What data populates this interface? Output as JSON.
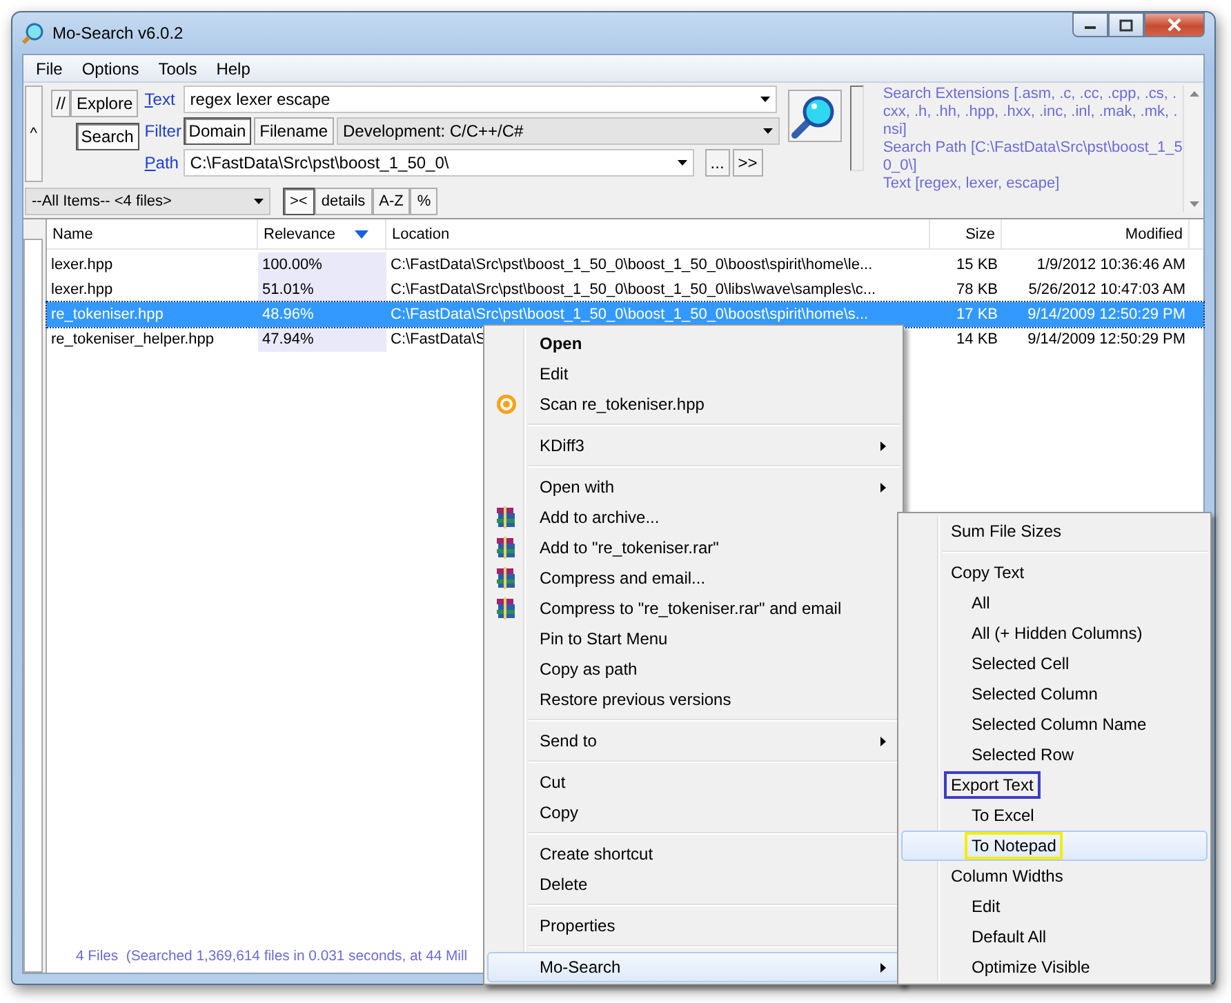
{
  "window": {
    "title": "Mo-Search v6.0.2"
  },
  "menu_bar": [
    "File",
    "Options",
    "Tools",
    "Help"
  ],
  "toolbar": {
    "collapse": "^",
    "mode_buttons": [
      {
        "label": "//",
        "selected": false
      },
      {
        "label": "Explore",
        "selected": false
      },
      {
        "label": "Search",
        "selected": true
      }
    ],
    "text": {
      "label": "Text",
      "value": "regex lexer escape"
    },
    "filter": {
      "label": "Filter",
      "toggles": [
        {
          "label": "Domain",
          "selected": true
        },
        {
          "label": "Filename",
          "selected": false
        }
      ],
      "value": "Development: C/C++/C#"
    },
    "path": {
      "label": "Path",
      "value": "C:\\FastData\\Src\\pst\\boost_1_50_0\\",
      "buttons": [
        "...",
        ">>"
      ]
    },
    "info": [
      "Search Extensions [.asm, .c, .cc, .cpp, .cs, .cxx, .h, .hh, .hpp, .hxx, .inc, .inl, .mak, .mk, .nsi]",
      "Search Path [C:\\FastData\\Src\\pst\\boost_1_50_0\\]",
      "Text [regex, lexer, escape]"
    ],
    "scope": "--All Items-- <4 files>",
    "view_buttons": [
      {
        "label": "><",
        "selected": true
      },
      {
        "label": "details",
        "selected": false
      },
      {
        "label": "A-Z",
        "selected": false
      },
      {
        "label": "%",
        "selected": false
      }
    ]
  },
  "table": {
    "columns": [
      {
        "label": "Name",
        "sorted": false
      },
      {
        "label": "Relevance",
        "sorted": true
      },
      {
        "label": "Location",
        "sorted": false
      },
      {
        "label": "Size",
        "sorted": false
      },
      {
        "label": "Modified",
        "sorted": false
      }
    ],
    "rows": [
      {
        "cells": [
          "lexer.hpp",
          "100.00%",
          "C:\\FastData\\Src\\pst\\boost_1_50_0\\boost_1_50_0\\boost\\spirit\\home\\le...",
          "15 KB",
          "1/9/2012 10:36:46 AM"
        ],
        "selected": false
      },
      {
        "cells": [
          "lexer.hpp",
          "51.01%",
          "C:\\FastData\\Src\\pst\\boost_1_50_0\\boost_1_50_0\\libs\\wave\\samples\\c...",
          "78 KB",
          "5/26/2012 10:47:03 AM"
        ],
        "selected": false
      },
      {
        "cells": [
          "re_tokeniser.hpp",
          "48.96%",
          "C:\\FastData\\Src\\pst\\boost_1_50_0\\boost_1_50_0\\boost\\spirit\\home\\s...",
          "17 KB",
          "9/14/2009 12:50:29 PM"
        ],
        "selected": true
      },
      {
        "cells": [
          "re_tokeniser_helper.hpp",
          "47.94%",
          "C:\\FastData\\S",
          "14 KB",
          "9/14/2009 12:50:29 PM"
        ],
        "selected": false
      }
    ]
  },
  "status_bar": "4 Files  (Searched 1,369,614 files in 0.031 seconds, at 44 Mill",
  "context_menu": [
    {
      "kind": "item",
      "label": "Open",
      "bold": true,
      "selected": false
    },
    {
      "kind": "item",
      "label": "Edit",
      "selected": false
    },
    {
      "kind": "scan",
      "label": "Scan re_tokeniser.hpp",
      "selected": false
    },
    {
      "kind": "separator"
    },
    {
      "kind": "item",
      "label": "KDiff3",
      "submenu": true,
      "selected": false
    },
    {
      "kind": "separator"
    },
    {
      "kind": "item",
      "label": "Open with",
      "submenu": true,
      "selected": false
    },
    {
      "kind": "archive",
      "label": "Add to archive...",
      "selected": false
    },
    {
      "kind": "archive",
      "label": "Add to \"re_tokeniser.rar\"",
      "selected": false
    },
    {
      "kind": "archive",
      "label": "Compress and email...",
      "selected": false
    },
    {
      "kind": "archive",
      "label": "Compress to \"re_tokeniser.rar\" and email",
      "selected": false
    },
    {
      "kind": "item",
      "label": "Pin to Start Menu",
      "selected": false
    },
    {
      "kind": "item",
      "label": "Copy as path",
      "selected": false
    },
    {
      "kind": "item",
      "label": "Restore previous versions",
      "selected": false
    },
    {
      "kind": "separator"
    },
    {
      "kind": "item",
      "label": "Send to",
      "submenu": true,
      "selected": false
    },
    {
      "kind": "separator"
    },
    {
      "kind": "item",
      "label": "Cut",
      "selected": false
    },
    {
      "kind": "item",
      "label": "Copy",
      "selected": false
    },
    {
      "kind": "separator"
    },
    {
      "kind": "item",
      "label": "Create shortcut",
      "selected": false
    },
    {
      "kind": "item",
      "label": "Delete",
      "selected": false
    },
    {
      "kind": "separator"
    },
    {
      "kind": "item",
      "label": "Properties",
      "selected": false
    },
    {
      "kind": "separator"
    },
    {
      "kind": "item",
      "label": "Mo-Search",
      "submenu": true,
      "selected": true
    }
  ],
  "submenu": [
    {
      "kind": "item",
      "label": "Sum File Sizes",
      "selected": false
    },
    {
      "kind": "separator"
    },
    {
      "kind": "item",
      "label": "Copy Text",
      "selected": false,
      "children": [
        {
          "kind": "item",
          "label": "All",
          "selected": false
        },
        {
          "kind": "item",
          "label": "All (+ Hidden Columns)",
          "selected": false
        },
        {
          "kind": "item",
          "label": "Selected Cell",
          "selected": false
        },
        {
          "kind": "item",
          "label": "Selected Column",
          "selected": false
        },
        {
          "kind": "item",
          "label": "Selected Column Name",
          "selected": false
        },
        {
          "kind": "item",
          "label": "Selected Row",
          "selected": false
        }
      ]
    },
    {
      "kind": "item",
      "label": "Export Text",
      "selected": false,
      "color": "#3c3cc8",
      "children": [
        {
          "kind": "item",
          "label": "To Excel",
          "selected": false
        },
        {
          "kind": "item",
          "label": "To Notepad",
          "selected": true,
          "color": "#f5ee00"
        }
      ]
    },
    {
      "kind": "item",
      "label": "Column Widths",
      "selected": false,
      "children": [
        {
          "kind": "item",
          "label": "Edit",
          "selected": false
        },
        {
          "kind": "item",
          "label": "Default All",
          "selected": false
        },
        {
          "kind": "item",
          "label": "Optimize Visible",
          "selected": false
        }
      ]
    }
  ]
}
